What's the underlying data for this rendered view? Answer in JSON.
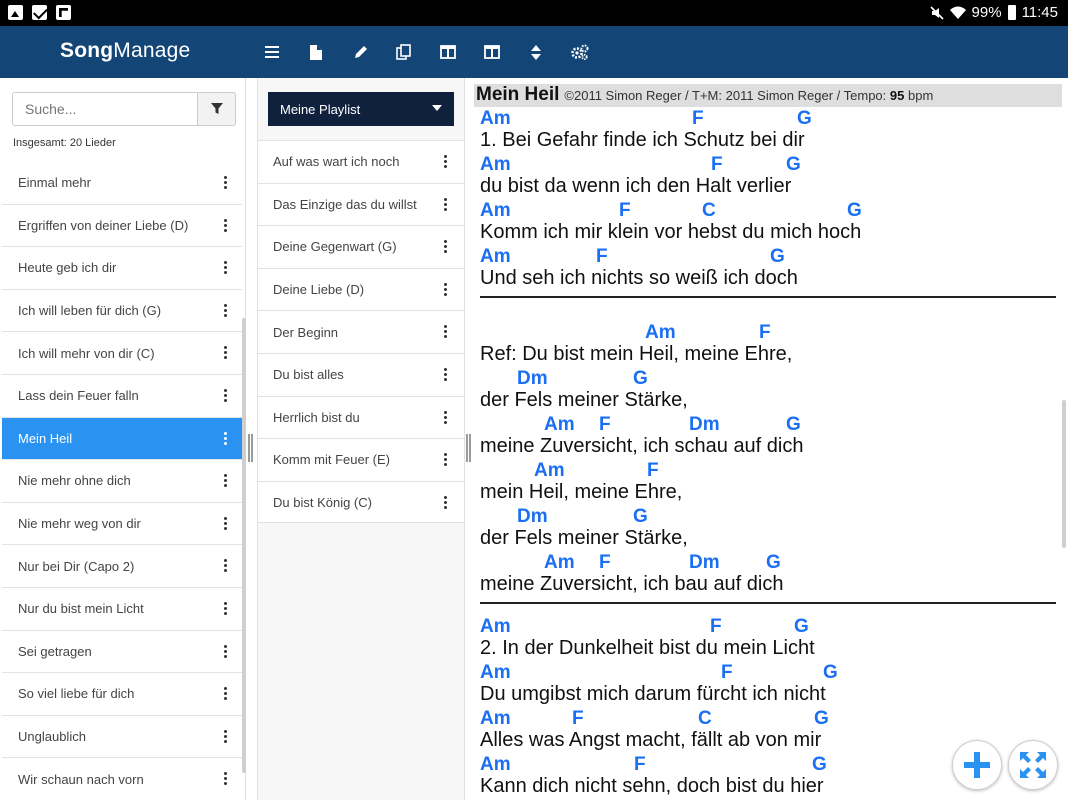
{
  "status_bar": {
    "battery": "99%",
    "time": "11:45"
  },
  "header": {
    "brand_bold": "Song",
    "brand_light": "Manage",
    "toolbar_icons": [
      "menu-icon",
      "file-icon",
      "pencil-icon",
      "copy-icon",
      "panel-left-icon",
      "columns-icon",
      "sort-icon",
      "cogs-icon"
    ]
  },
  "sidebar": {
    "search_placeholder": "Suche...",
    "total_label": "Insgesamt: 20 Lieder",
    "songs": [
      {
        "label": "Einmal mehr"
      },
      {
        "label": "Ergriffen von deiner Liebe (D)"
      },
      {
        "label": "Heute geb ich dir"
      },
      {
        "label": "Ich will leben für dich (G)"
      },
      {
        "label": "Ich will mehr von dir (C)"
      },
      {
        "label": "Lass dein Feuer falln"
      },
      {
        "label": "Mein Heil",
        "active": true
      },
      {
        "label": "Nie mehr ohne dich"
      },
      {
        "label": "Nie mehr weg von dir"
      },
      {
        "label": "Nur bei Dir (Capo 2)"
      },
      {
        "label": "Nur du bist mein Licht"
      },
      {
        "label": "Sei getragen"
      },
      {
        "label": "So viel liebe für dich"
      },
      {
        "label": "Unglaublich"
      },
      {
        "label": "Wir schaun nach vorn"
      }
    ]
  },
  "playlist": {
    "selected": "Meine Playlist",
    "items": [
      {
        "label": "Auf was wart ich noch"
      },
      {
        "label": "Das Einzige das du willst"
      },
      {
        "label": "Deine Gegenwart (G)"
      },
      {
        "label": "Deine Liebe (D)"
      },
      {
        "label": "Der Beginn"
      },
      {
        "label": "Du bist alles"
      },
      {
        "label": "Herrlich bist du"
      },
      {
        "label": "Komm mit Feuer (E)"
      },
      {
        "label": "Du bist König (C)"
      }
    ]
  },
  "song": {
    "title": "Mein Heil",
    "meta_prefix": "©2011 Simon Reger / T+M: 2011 Simon Reger / Tempo:",
    "tempo": "95",
    "tempo_unit": "bpm",
    "chord_color": "#1a6ff2",
    "blocks": [
      {
        "type": "verse",
        "lines": [
          {
            "chords": [
              {
                "c": "Am",
                "pos": 0
              },
              {
                "c": "F",
                "pos": 212
              },
              {
                "c": "G",
                "pos": 317
              }
            ],
            "text": "1. Bei Gefahr finde ich Schutz bei dir"
          },
          {
            "chords": [
              {
                "c": "Am",
                "pos": 0
              },
              {
                "c": "F",
                "pos": 231
              },
              {
                "c": "G",
                "pos": 306
              }
            ],
            "text": "du bist da wenn ich den Halt verlier"
          },
          {
            "chords": [
              {
                "c": "Am",
                "pos": 0
              },
              {
                "c": "F",
                "pos": 139
              },
              {
                "c": "C",
                "pos": 222
              },
              {
                "c": "G",
                "pos": 367
              }
            ],
            "text": "Komm ich mir klein vor hebst du mich hoch"
          },
          {
            "chords": [
              {
                "c": "Am",
                "pos": 0
              },
              {
                "c": "F",
                "pos": 116
              },
              {
                "c": "G",
                "pos": 290
              }
            ],
            "text": "Und seh ich nichts so weiß ich doch"
          }
        ]
      },
      {
        "type": "ref",
        "lines": [
          {
            "chords": [
              {
                "c": "Am",
                "pos": 165
              },
              {
                "c": "F",
                "pos": 279
              }
            ],
            "text": "Ref: Du bist mein Heil, meine Ehre,"
          },
          {
            "chords": [
              {
                "c": "Dm",
                "pos": 37
              },
              {
                "c": "G",
                "pos": 153
              }
            ],
            "text": "der Fels meiner Stärke,"
          },
          {
            "chords": [
              {
                "c": "Am",
                "pos": 64
              },
              {
                "c": "F",
                "pos": 119
              },
              {
                "c": "Dm",
                "pos": 209
              },
              {
                "c": "G",
                "pos": 306
              }
            ],
            "text": "meine Zuversicht, ich schau auf dich"
          },
          {
            "chords": [
              {
                "c": "Am",
                "pos": 54
              },
              {
                "c": "F",
                "pos": 167
              }
            ],
            "text": "mein Heil, meine Ehre,"
          },
          {
            "chords": [
              {
                "c": "Dm",
                "pos": 37
              },
              {
                "c": "G",
                "pos": 153
              }
            ],
            "text": "der Fels meiner Stärke,"
          },
          {
            "chords": [
              {
                "c": "Am",
                "pos": 64
              },
              {
                "c": "F",
                "pos": 119
              },
              {
                "c": "Dm",
                "pos": 209
              },
              {
                "c": "G",
                "pos": 286
              }
            ],
            "text": "meine Zuversicht, ich bau auf dich"
          }
        ]
      },
      {
        "type": "verse",
        "lines": [
          {
            "chords": [
              {
                "c": "Am",
                "pos": 0
              },
              {
                "c": "F",
                "pos": 230
              },
              {
                "c": "G",
                "pos": 314
              }
            ],
            "text": "2. In der Dunkelheit bist du mein Licht"
          },
          {
            "chords": [
              {
                "c": "Am",
                "pos": 0
              },
              {
                "c": "F",
                "pos": 241
              },
              {
                "c": "G",
                "pos": 343
              }
            ],
            "text": "Du umgibst mich darum fürcht ich nicht"
          },
          {
            "chords": [
              {
                "c": "Am",
                "pos": 0
              },
              {
                "c": "F",
                "pos": 92
              },
              {
                "c": "C",
                "pos": 218
              },
              {
                "c": "G",
                "pos": 334
              }
            ],
            "text": "Alles was Angst macht, fällt ab von mir"
          },
          {
            "chords": [
              {
                "c": "Am",
                "pos": 0
              },
              {
                "c": "F",
                "pos": 154
              },
              {
                "c": "G",
                "pos": 332
              }
            ],
            "text": "Kann dich nicht sehn, doch bist du hier"
          }
        ]
      }
    ]
  }
}
